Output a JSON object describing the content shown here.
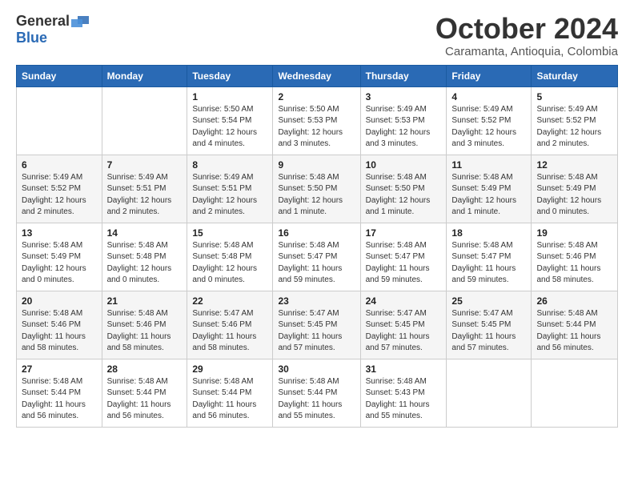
{
  "header": {
    "logo_general": "General",
    "logo_blue": "Blue",
    "month_title": "October 2024",
    "location": "Caramanta, Antioquia, Colombia"
  },
  "days_of_week": [
    "Sunday",
    "Monday",
    "Tuesday",
    "Wednesday",
    "Thursday",
    "Friday",
    "Saturday"
  ],
  "weeks": [
    [
      {
        "day": "",
        "info": ""
      },
      {
        "day": "",
        "info": ""
      },
      {
        "day": "1",
        "info": "Sunrise: 5:50 AM\nSunset: 5:54 PM\nDaylight: 12 hours and 4 minutes."
      },
      {
        "day": "2",
        "info": "Sunrise: 5:50 AM\nSunset: 5:53 PM\nDaylight: 12 hours and 3 minutes."
      },
      {
        "day": "3",
        "info": "Sunrise: 5:49 AM\nSunset: 5:53 PM\nDaylight: 12 hours and 3 minutes."
      },
      {
        "day": "4",
        "info": "Sunrise: 5:49 AM\nSunset: 5:52 PM\nDaylight: 12 hours and 3 minutes."
      },
      {
        "day": "5",
        "info": "Sunrise: 5:49 AM\nSunset: 5:52 PM\nDaylight: 12 hours and 2 minutes."
      }
    ],
    [
      {
        "day": "6",
        "info": "Sunrise: 5:49 AM\nSunset: 5:52 PM\nDaylight: 12 hours and 2 minutes."
      },
      {
        "day": "7",
        "info": "Sunrise: 5:49 AM\nSunset: 5:51 PM\nDaylight: 12 hours and 2 minutes."
      },
      {
        "day": "8",
        "info": "Sunrise: 5:49 AM\nSunset: 5:51 PM\nDaylight: 12 hours and 2 minutes."
      },
      {
        "day": "9",
        "info": "Sunrise: 5:48 AM\nSunset: 5:50 PM\nDaylight: 12 hours and 1 minute."
      },
      {
        "day": "10",
        "info": "Sunrise: 5:48 AM\nSunset: 5:50 PM\nDaylight: 12 hours and 1 minute."
      },
      {
        "day": "11",
        "info": "Sunrise: 5:48 AM\nSunset: 5:49 PM\nDaylight: 12 hours and 1 minute."
      },
      {
        "day": "12",
        "info": "Sunrise: 5:48 AM\nSunset: 5:49 PM\nDaylight: 12 hours and 0 minutes."
      }
    ],
    [
      {
        "day": "13",
        "info": "Sunrise: 5:48 AM\nSunset: 5:49 PM\nDaylight: 12 hours and 0 minutes."
      },
      {
        "day": "14",
        "info": "Sunrise: 5:48 AM\nSunset: 5:48 PM\nDaylight: 12 hours and 0 minutes."
      },
      {
        "day": "15",
        "info": "Sunrise: 5:48 AM\nSunset: 5:48 PM\nDaylight: 12 hours and 0 minutes."
      },
      {
        "day": "16",
        "info": "Sunrise: 5:48 AM\nSunset: 5:47 PM\nDaylight: 11 hours and 59 minutes."
      },
      {
        "day": "17",
        "info": "Sunrise: 5:48 AM\nSunset: 5:47 PM\nDaylight: 11 hours and 59 minutes."
      },
      {
        "day": "18",
        "info": "Sunrise: 5:48 AM\nSunset: 5:47 PM\nDaylight: 11 hours and 59 minutes."
      },
      {
        "day": "19",
        "info": "Sunrise: 5:48 AM\nSunset: 5:46 PM\nDaylight: 11 hours and 58 minutes."
      }
    ],
    [
      {
        "day": "20",
        "info": "Sunrise: 5:48 AM\nSunset: 5:46 PM\nDaylight: 11 hours and 58 minutes."
      },
      {
        "day": "21",
        "info": "Sunrise: 5:48 AM\nSunset: 5:46 PM\nDaylight: 11 hours and 58 minutes."
      },
      {
        "day": "22",
        "info": "Sunrise: 5:47 AM\nSunset: 5:46 PM\nDaylight: 11 hours and 58 minutes."
      },
      {
        "day": "23",
        "info": "Sunrise: 5:47 AM\nSunset: 5:45 PM\nDaylight: 11 hours and 57 minutes."
      },
      {
        "day": "24",
        "info": "Sunrise: 5:47 AM\nSunset: 5:45 PM\nDaylight: 11 hours and 57 minutes."
      },
      {
        "day": "25",
        "info": "Sunrise: 5:47 AM\nSunset: 5:45 PM\nDaylight: 11 hours and 57 minutes."
      },
      {
        "day": "26",
        "info": "Sunrise: 5:48 AM\nSunset: 5:44 PM\nDaylight: 11 hours and 56 minutes."
      }
    ],
    [
      {
        "day": "27",
        "info": "Sunrise: 5:48 AM\nSunset: 5:44 PM\nDaylight: 11 hours and 56 minutes."
      },
      {
        "day": "28",
        "info": "Sunrise: 5:48 AM\nSunset: 5:44 PM\nDaylight: 11 hours and 56 minutes."
      },
      {
        "day": "29",
        "info": "Sunrise: 5:48 AM\nSunset: 5:44 PM\nDaylight: 11 hours and 56 minutes."
      },
      {
        "day": "30",
        "info": "Sunrise: 5:48 AM\nSunset: 5:44 PM\nDaylight: 11 hours and 55 minutes."
      },
      {
        "day": "31",
        "info": "Sunrise: 5:48 AM\nSunset: 5:43 PM\nDaylight: 11 hours and 55 minutes."
      },
      {
        "day": "",
        "info": ""
      },
      {
        "day": "",
        "info": ""
      }
    ]
  ]
}
